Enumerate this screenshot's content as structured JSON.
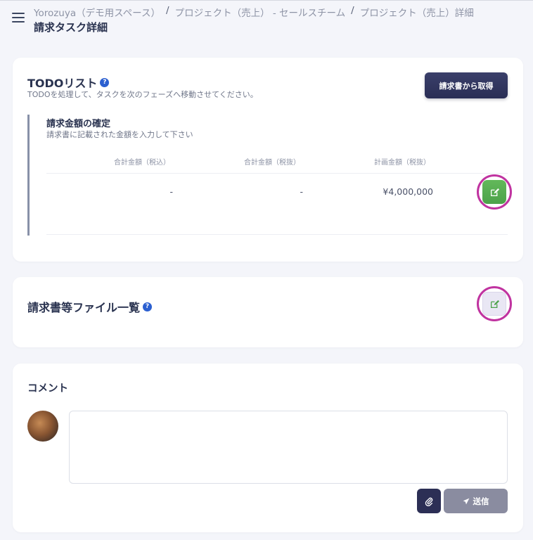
{
  "header": {
    "breadcrumb": [
      "Yorozuya（デモ用スペース）",
      "プロジェクト（売上） - セールスチーム",
      "プロジェクト（売上）詳細"
    ],
    "separator": "/",
    "page_title": "請求タスク詳細"
  },
  "todo_card": {
    "title": "TODOリスト",
    "help": "?",
    "subtitle": "TODOを処理して、タスクを次のフェーズへ移動させてください。",
    "fetch_button": "請求書から取得",
    "task": {
      "title": "請求金額の確定",
      "subtitle": "請求書に記載された金額を入力して下さい",
      "columns": [
        "合計金額（税込）",
        "合計金額（税抜）",
        "計画金額（税抜）"
      ],
      "values": [
        "-",
        "-",
        "¥4,000,000"
      ]
    }
  },
  "files_card": {
    "title": "請求書等ファイル一覧",
    "help": "?"
  },
  "comment_card": {
    "title": "コメント",
    "comment_value": "",
    "send_label": "送信"
  },
  "colors": {
    "accent_dark": "#2c2f55",
    "edit_green": "#4ca24a",
    "highlight_ring": "#c033a0",
    "help_blue": "#2b5fd0",
    "send_disabled": "#8a8ca0"
  },
  "icons": {
    "menu": "hamburger-menu-icon",
    "help": "question-circle-icon",
    "edit": "edit-square-icon",
    "attach": "paperclip-icon",
    "send": "paper-plane-icon"
  }
}
